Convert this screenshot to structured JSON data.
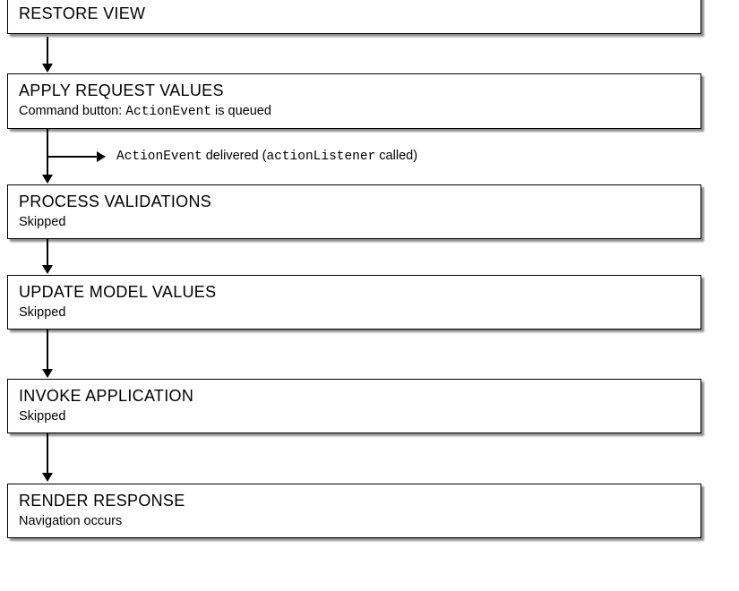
{
  "steps": [
    {
      "title": "RESTORE VIEW",
      "subtitle": null
    },
    {
      "title": "APPLY REQUEST VALUES",
      "subtitle_pre": "Command button: ",
      "subtitle_mono": "ActionEvent",
      "subtitle_post": " is queued"
    },
    {
      "title": "PROCESS VALIDATIONS",
      "subtitle": "Skipped"
    },
    {
      "title": "UPDATE MODEL VALUES",
      "subtitle": "Skipped"
    },
    {
      "title": "INVOKE APPLICATION",
      "subtitle": "Skipped"
    },
    {
      "title": "RENDER RESPONSE",
      "subtitle": "Navigation occurs"
    }
  ],
  "annotation": {
    "mono1": "ActionEvent",
    "txt1": " delivered (",
    "mono2": "actionListener",
    "txt2": " called)"
  }
}
